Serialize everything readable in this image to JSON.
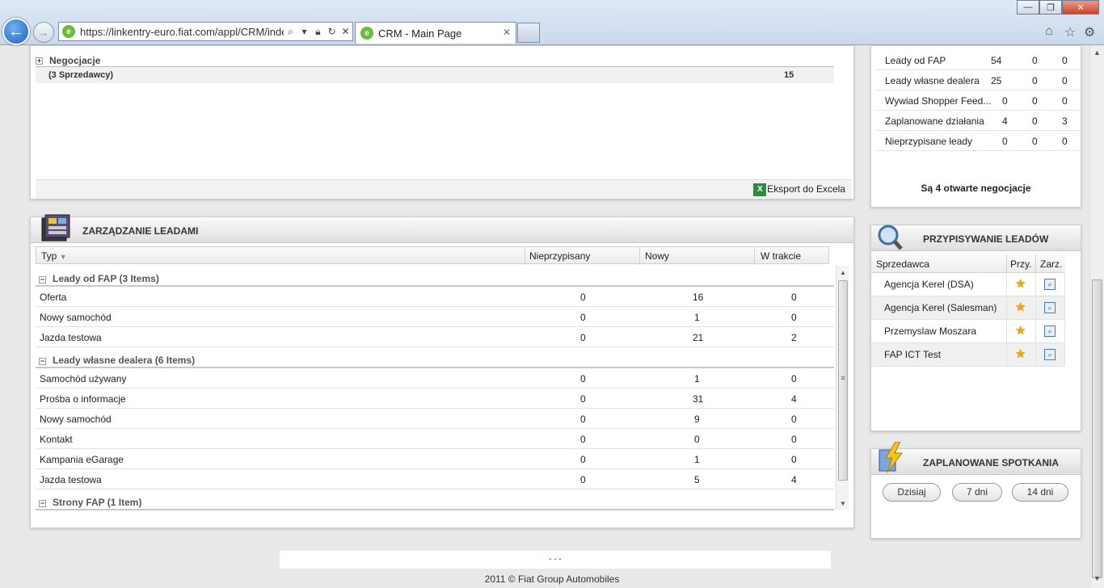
{
  "browser": {
    "url": "https://linkentry-euro.fiat.com/appl/CRM/index",
    "tab_title": "CRM - Main Page"
  },
  "negotiations": {
    "group_label": "Negocjacje",
    "subtotal_label": "(3 Sprzedawcy)",
    "subtotal_value": "15",
    "export_label": "Eksport do Excela"
  },
  "leads_panel": {
    "title": "ZARZĄDZANIE LEADAMI",
    "columns": [
      "Typ",
      "Nieprzypisany",
      "Nowy",
      "W trakcie"
    ],
    "groups": [
      {
        "label": "Leady od FAP (3 Items)",
        "rows": [
          {
            "type": "Oferta",
            "unassigned": "0",
            "new": "16",
            "in_progress": "0"
          },
          {
            "type": "Nowy samochód",
            "unassigned": "0",
            "new": "1",
            "in_progress": "0"
          },
          {
            "type": "Jazda testowa",
            "unassigned": "0",
            "new": "21",
            "in_progress": "2"
          }
        ]
      },
      {
        "label": "Leady własne dealera (6 Items)",
        "rows": [
          {
            "type": "Samochód używany",
            "unassigned": "0",
            "new": "1",
            "in_progress": "0"
          },
          {
            "type": "Prośba o informacje",
            "unassigned": "0",
            "new": "31",
            "in_progress": "4"
          },
          {
            "type": "Nowy samochód",
            "unassigned": "0",
            "new": "9",
            "in_progress": "0"
          },
          {
            "type": "Kontakt",
            "unassigned": "0",
            "new": "0",
            "in_progress": "0"
          },
          {
            "type": "Kampania eGarage",
            "unassigned": "0",
            "new": "1",
            "in_progress": "0"
          },
          {
            "type": "Jazda testowa",
            "unassigned": "0",
            "new": "5",
            "in_progress": "4"
          }
        ]
      },
      {
        "label": "Strony FAP (1 Item)",
        "rows": []
      }
    ]
  },
  "stats": {
    "rows": [
      {
        "label": "Leady od FAP",
        "a": "54",
        "b": "0",
        "c": "0"
      },
      {
        "label": "Leady własne dealera",
        "a": "25",
        "b": "0",
        "c": "0"
      },
      {
        "label": "Wywiad Shopper Feed...",
        "a": "0",
        "b": "0",
        "c": "0"
      },
      {
        "label": "Zaplanowane działania",
        "a": "4",
        "b": "0",
        "c": "3"
      },
      {
        "label": "Nieprzypisane leady",
        "a": "0",
        "b": "0",
        "c": "0"
      }
    ],
    "open_negotiations": "Są 4 otwarte negocjacje"
  },
  "assign_panel": {
    "title": "PRZYPISYWANIE LEADÓW",
    "columns": [
      "Sprzedawca",
      "Przy.",
      "Zarz."
    ],
    "rows": [
      {
        "name": "Agencja Kerel (DSA)"
      },
      {
        "name": "Agencja Kerel (Salesman)"
      },
      {
        "name": "Przemyslaw Moszara"
      },
      {
        "name": "FAP ICT Test"
      }
    ]
  },
  "meetings_panel": {
    "title": "ZAPLANOWANE SPOTKANIA",
    "buttons": [
      "Dzisiaj",
      "7 dni",
      "14 dni"
    ]
  },
  "footer": {
    "separator": "- - -",
    "copyright": "2011 © Fiat Group Automobiles"
  }
}
